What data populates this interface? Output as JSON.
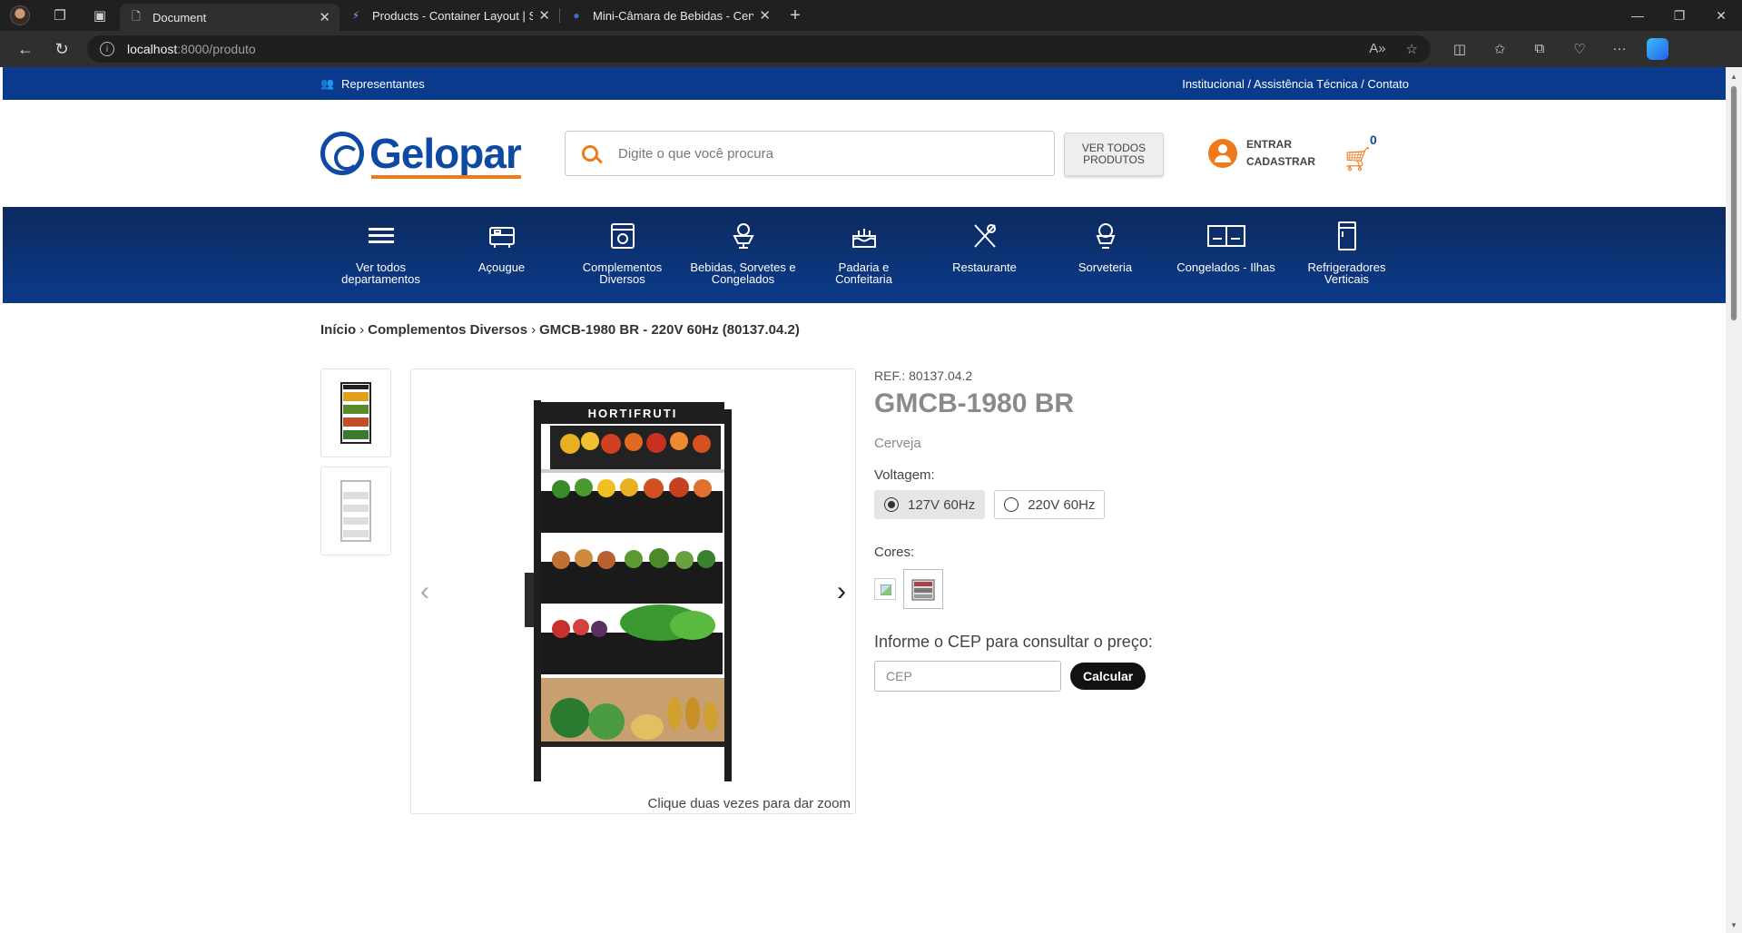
{
  "browser": {
    "tabs": [
      {
        "title": "Document",
        "active": true,
        "icon": "page-icon"
      },
      {
        "title": "Products - Container Layout | Sne",
        "active": false,
        "icon": "snippet-icon"
      },
      {
        "title": "Mini-Câmara de Bebidas - Cervej",
        "active": false,
        "icon": "gelopar-icon"
      }
    ],
    "url_host": "localhost",
    "url_path": ":8000/produto"
  },
  "topstrip": {
    "representantes": "Representantes",
    "links": "Institucional / Assistência Técnica / Contato"
  },
  "header": {
    "logo_text": "Gelopar",
    "search_placeholder": "Digite o que você procura",
    "ver_todos": "VER TODOS PRODUTOS",
    "entrar": "ENTRAR",
    "cadastrar": "CADASTRAR",
    "cart_count": "0"
  },
  "categories": [
    {
      "label": "Ver todos departamentos",
      "icon": "menu-icon"
    },
    {
      "label": "Açougue",
      "icon": "meat-counter-icon"
    },
    {
      "label": "Complementos Diversos",
      "icon": "display-case-icon"
    },
    {
      "label": "Bebidas, Sorvetes e Congelados",
      "icon": "ice-cream-bowl-icon"
    },
    {
      "label": "Padaria e Confeitaria",
      "icon": "cake-icon"
    },
    {
      "label": "Restaurante",
      "icon": "cutlery-icon"
    },
    {
      "label": "Sorveteria",
      "icon": "ice-cream-icon"
    },
    {
      "label": "Congelados - Ilhas",
      "icon": "freezer-island-icon"
    },
    {
      "label": "Refrigeradores Verticais",
      "icon": "fridge-icon"
    }
  ],
  "breadcrumb": {
    "home": "Início",
    "category": "Complementos Diversos",
    "current": "GMCB-1980 BR - 220V 60Hz (80137.04.2)"
  },
  "product": {
    "ref": "REF.: 80137.04.2",
    "title": "GMCB-1980 BR",
    "subcategory": "Cerveja",
    "voltage_label": "Voltagem:",
    "voltages": [
      {
        "label": "127V 60Hz",
        "selected": true
      },
      {
        "label": "220V 60Hz",
        "selected": false
      }
    ],
    "colors_label": "Cores:",
    "zoom_hint": "Clique duas vezes para dar zoom",
    "image_sign": "HORTIFRUTI",
    "cep_label": "Informe o CEP para consultar o preço:",
    "cep_placeholder": "CEP",
    "calc_button": "Calcular"
  },
  "colors": {
    "brand_blue": "#0e4aa3",
    "brand_orange": "#f07a1a",
    "nav_dark": "#0c2a5e"
  }
}
